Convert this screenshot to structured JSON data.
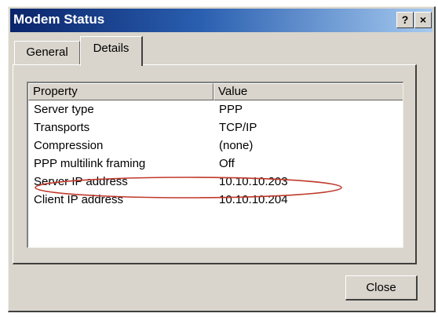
{
  "window": {
    "title": "Modem Status",
    "help_button": "?",
    "close_button": "×"
  },
  "tabs": [
    {
      "label": "General",
      "selected": false
    },
    {
      "label": "Details",
      "selected": true
    }
  ],
  "listview": {
    "columns": [
      "Property",
      "Value"
    ],
    "rows": [
      {
        "property": "Server type",
        "value": "PPP"
      },
      {
        "property": "Transports",
        "value": "TCP/IP"
      },
      {
        "property": "Compression",
        "value": "(none)"
      },
      {
        "property": "PPP multilink framing",
        "value": "Off"
      },
      {
        "property": "Server IP address",
        "value": "10.10.10.203"
      },
      {
        "property": "Client IP address",
        "value": "10.10.10.204"
      }
    ],
    "highlighted_row": "Server IP address"
  },
  "buttons": {
    "close_label": "Close"
  },
  "colors": {
    "titlebar_start": "#0a246a",
    "titlebar_end": "#a6caf0",
    "dialog_face": "#d9d5cc",
    "highlight_ellipse": "#c0392b"
  }
}
